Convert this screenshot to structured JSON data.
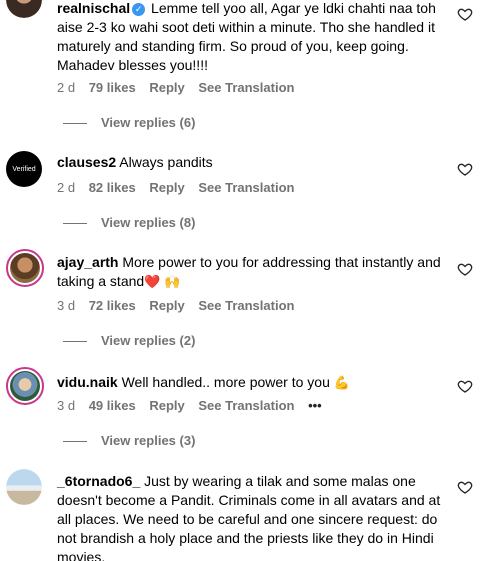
{
  "comments": [
    {
      "username": "realnischal",
      "verified": true,
      "text": "Lemme tell yoo all, Agar ye ldki chahti naa toh aise 2-3 ko wahi soot deti within a minute. Tho she handled it maturely and standing firm. So proud of you, keep going. Mahadev blesses you!!!!",
      "time": "2 d",
      "likes": "79 likes",
      "reply": "Reply",
      "translate": "See Translation",
      "view_replies": "View replies (6)"
    },
    {
      "username": "clauses2",
      "avatar_text": "Verified",
      "text": "Always pandits",
      "time": "2 d",
      "likes": "82 likes",
      "reply": "Reply",
      "translate": "See Translation",
      "view_replies": "View replies (8)"
    },
    {
      "username": "ajay_arth",
      "text": "More power to you for addressing that instantly and taking a stand",
      "emoji": "❤️ 🙌",
      "time": "3 d",
      "likes": "72 likes",
      "reply": "Reply",
      "translate": "See Translation",
      "view_replies": "View replies (2)"
    },
    {
      "username": "vidu.naik",
      "text": "Well handled.. more power to you",
      "emoji": "💪",
      "time": "3 d",
      "likes": "49 likes",
      "reply": "Reply",
      "translate": "See Translation",
      "more": "•••",
      "view_replies": "View replies (3)"
    },
    {
      "username": "_6tornado6_",
      "text": "Just by wearing a tilak and some malas one doesn't become a Pandit. Criminals come in all avatars and at all places. We need to be careful and one sincere request: do not brandish a holy place and the priests like they do in Hindi movies."
    }
  ]
}
